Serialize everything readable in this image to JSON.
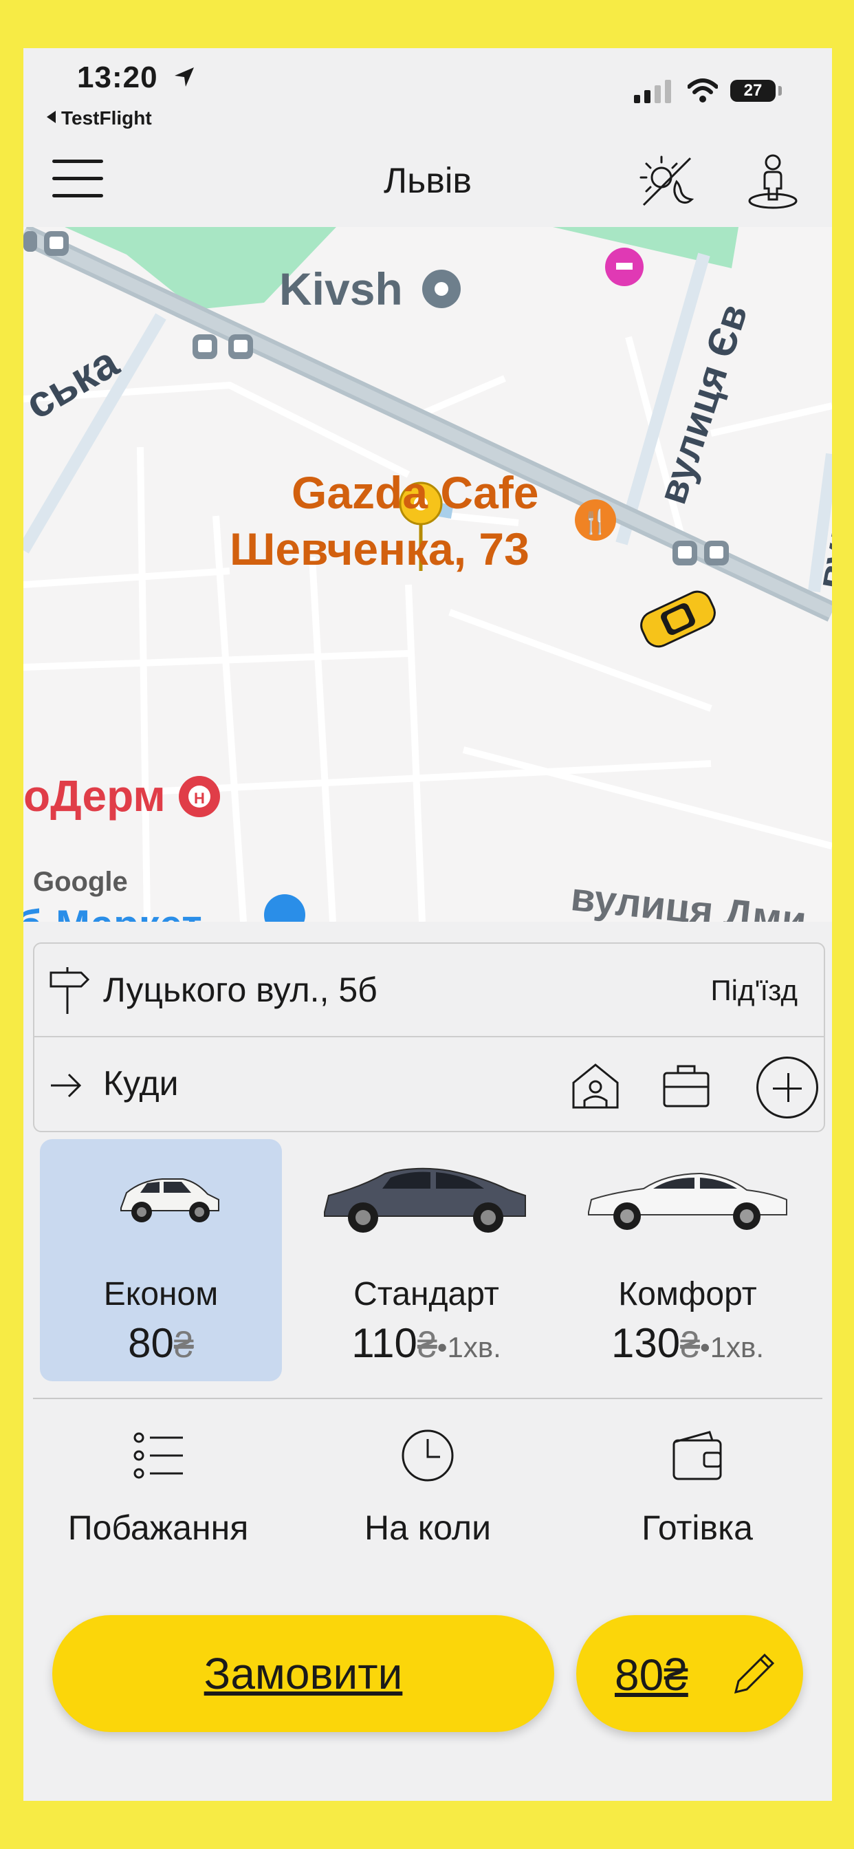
{
  "status_bar": {
    "time": "13:20",
    "back_app": "TestFlight",
    "battery": "27"
  },
  "header": {
    "city": "Львів"
  },
  "map": {
    "labels": {
      "kivsh": "Kivsh",
      "cafe_line1": "Gazda Cafe",
      "cafe_line2": "Шевченка, 73",
      "derm": "оДерм",
      "street_ska": "ська",
      "street_vul1": "вулиця Єв",
      "street_vul2": "вулиц",
      "street_dm": "вулиця Дми",
      "market": "б-Маркет",
      "google": "Google"
    }
  },
  "address": {
    "from": "Луцького вул., 5б",
    "entrance": "Під'їзд",
    "to_placeholder": "Куди"
  },
  "tariffs": [
    {
      "name": "Економ",
      "price": "80",
      "currency": "₴",
      "eta": ""
    },
    {
      "name": "Стандарт",
      "price": "110",
      "currency": "₴",
      "eta": "•1хв."
    },
    {
      "name": "Комфорт",
      "price": "130",
      "currency": "₴",
      "eta": "•1хв."
    }
  ],
  "options": {
    "wishes": "Побажання",
    "on_wheels": "На коли",
    "payment": "Готівка"
  },
  "actions": {
    "order": "Замовити",
    "price": "80₴"
  },
  "colors": {
    "accent": "#FBD60A",
    "frame": "#F7EB45",
    "selected_tariff": "#C9D9EF",
    "poi_orange": "#D2600E",
    "poi_red": "#E03D48"
  }
}
